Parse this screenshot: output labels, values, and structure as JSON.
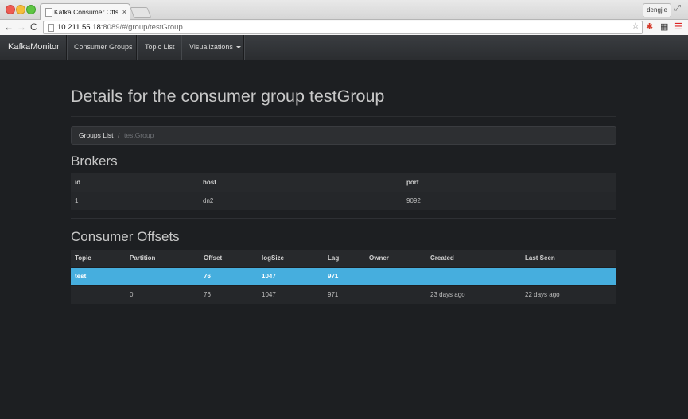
{
  "browser": {
    "tab_title": "Kafka Consumer Offset Mo",
    "tab_close": "×",
    "user_button": "dengjie",
    "url_host": "10.211.55.18",
    "url_rest": ":8089/#/group/testGroup",
    "nav_back": "←",
    "nav_forward": "→",
    "nav_reload": "C",
    "bookmark_star": "☆",
    "fullscreen_glyph": "⤢",
    "ext_1": "✱",
    "ext_2": "▦",
    "ext_3": "☰"
  },
  "navbar": {
    "brand": "KafkaMonitor",
    "links": [
      "Consumer Groups",
      "Topic List",
      "Visualizations"
    ]
  },
  "page": {
    "title": "Details for the consumer group testGroup",
    "breadcrumb": {
      "link": "Groups List",
      "separator": "/",
      "active": "testGroup"
    }
  },
  "brokers": {
    "title": "Brokers",
    "columns": [
      "id",
      "host",
      "port"
    ],
    "rows": [
      [
        "1",
        "dn2",
        "9092"
      ]
    ]
  },
  "offsets": {
    "title": "Consumer Offsets",
    "columns": [
      "Topic",
      "Partition",
      "Offset",
      "logSize",
      "Lag",
      "Owner",
      "Created",
      "Last Seen"
    ],
    "rows": [
      [
        "test",
        "",
        "76",
        "1047",
        "971",
        "",
        "",
        ""
      ],
      [
        "",
        "0",
        "76",
        "1047",
        "971",
        "",
        "23 days ago",
        "22 days ago"
      ]
    ]
  },
  "colors": {
    "accent": "#46aede",
    "background": "#1d1f22",
    "navbar": "#2b2d30"
  }
}
